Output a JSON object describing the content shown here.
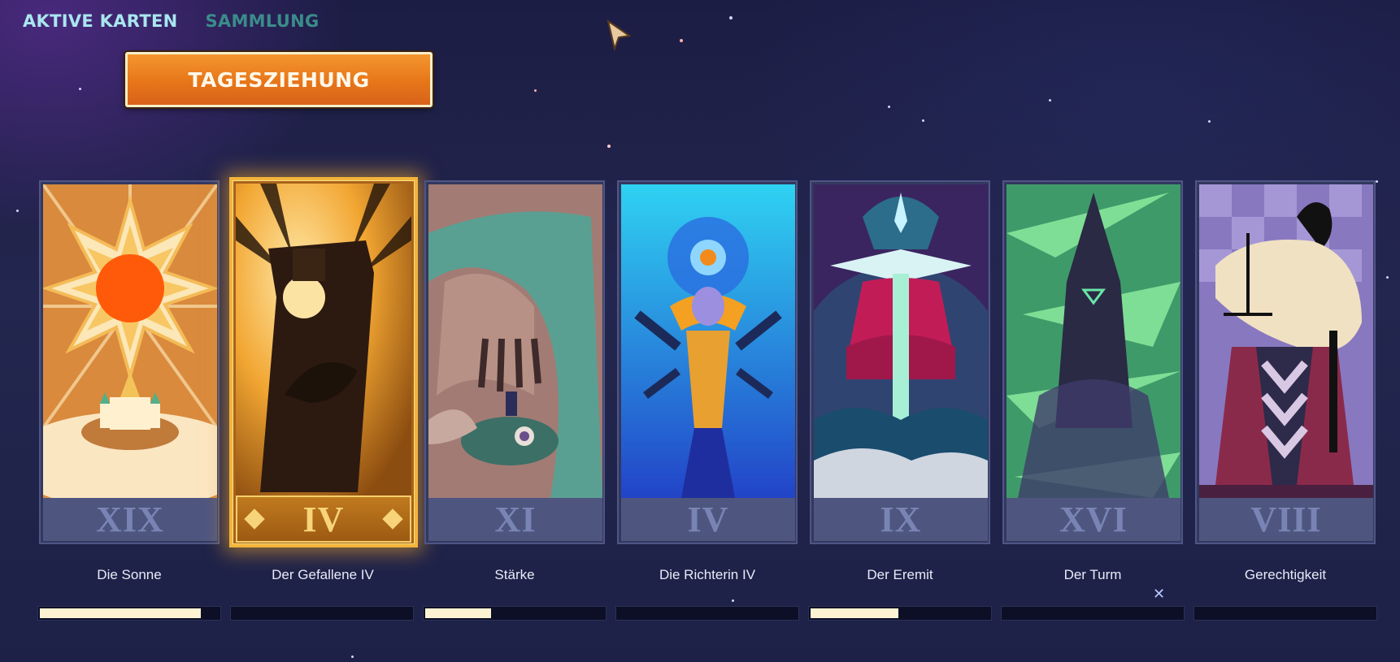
{
  "tabs": [
    {
      "label": "AKTIVE KARTEN",
      "active": true
    },
    {
      "label": "SAMMLUNG",
      "active": false
    }
  ],
  "daily_draw_button": {
    "label": "TAGESZIEHUNG"
  },
  "cards": [
    {
      "numeral": "XIX",
      "name": "Die Sonne",
      "progress": 0.9,
      "selected": false
    },
    {
      "numeral": "IV",
      "name": "Der Gefallene IV",
      "progress": 0.0,
      "selected": true
    },
    {
      "numeral": "XI",
      "name": "Stärke",
      "progress": 0.38,
      "selected": false
    },
    {
      "numeral": "IV",
      "name": "Die Richterin IV",
      "progress": 0.0,
      "selected": false
    },
    {
      "numeral": "IX",
      "name": "Der Eremit",
      "progress": 0.5,
      "selected": false
    },
    {
      "numeral": "XVI",
      "name": "Der Turm",
      "progress": 0.0,
      "selected": false
    },
    {
      "numeral": "VIII",
      "name": "Gerechtigkeit",
      "progress": 0.0,
      "selected": false
    }
  ],
  "colors": {
    "accent_tab": "#a9e6ef",
    "inactive_tab": "#3a8c8a",
    "button_orange": "#e77619",
    "progress_fill": "#fdf3d2",
    "selected_glow": "#f2b43a"
  }
}
